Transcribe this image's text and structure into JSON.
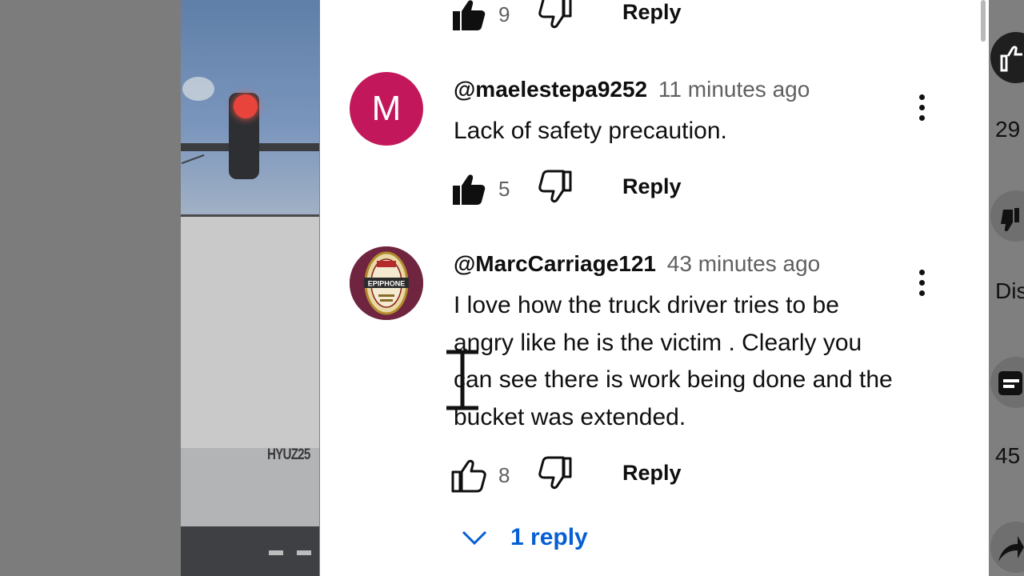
{
  "video": {
    "plate_text": "HYUZ25"
  },
  "right_rail": {
    "like_count": "29",
    "dislike_label": "Disli",
    "comment_count": "45"
  },
  "comments": [
    {
      "author": "",
      "time": "",
      "text": "",
      "likes": "9",
      "reply_label": "Reply"
    },
    {
      "avatar_letter": "M",
      "avatar_color": "#c2185b",
      "author": "@maelestepa9252",
      "time": "11 minutes ago",
      "text": "Lack of safety precaution.",
      "likes": "5",
      "reply_label": "Reply"
    },
    {
      "avatar_icon": "epiphone-logo",
      "author": "@MarcCarriage121",
      "time": "43 minutes ago",
      "text": "I love how the truck driver tries to be angry like he is the victim . Clearly you can see there is work being done and the bucket was extended.",
      "likes": "8",
      "reply_label": "Reply",
      "replies_label": "1 reply"
    }
  ],
  "colors": {
    "link_blue": "#065fd4",
    "text": "#0f0f0f",
    "secondary_text": "#606060"
  },
  "avatar_logo_text": "EPIPHONE"
}
